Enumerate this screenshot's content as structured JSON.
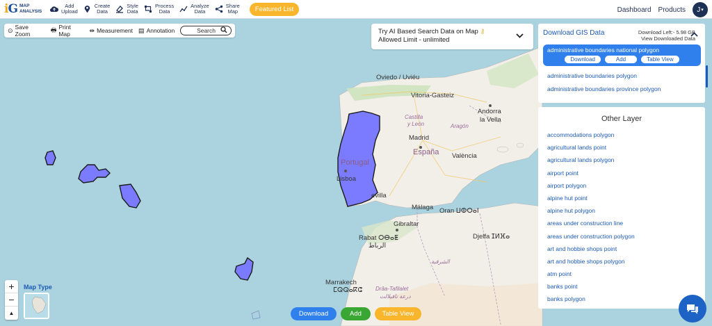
{
  "brand": {
    "mark_i": "i",
    "mark_g": "G",
    "line1": "MAP",
    "line2": "ANALYSIS"
  },
  "nav": [
    {
      "id": "add-upload",
      "line1": "Add",
      "line2": "Upload",
      "icon": "cloud-upload-icon"
    },
    {
      "id": "create-data",
      "line1": "Create",
      "line2": "Data",
      "icon": "map-pin-icon"
    },
    {
      "id": "style-data",
      "line1": "Style",
      "line2": "Data",
      "icon": "style-icon"
    },
    {
      "id": "process-data",
      "line1": "Process",
      "line2": "Data",
      "icon": "process-icon"
    },
    {
      "id": "analyze-data",
      "line1": "Analyze",
      "line2": "Data",
      "icon": "analyze-icon"
    },
    {
      "id": "share-map",
      "line1": "Share",
      "line2": "Map",
      "icon": "share-icon"
    }
  ],
  "featured_label": "Featured List",
  "top_right": {
    "dashboard": "Dashboard",
    "products": "Products",
    "avatar_initial": "J"
  },
  "toolbar": {
    "save_zoom": "Save Zoom",
    "print_map": "Print Map",
    "measurement": "Measurement",
    "annotation": "Annotation",
    "search": "Search"
  },
  "ai_search": {
    "line1": "Try AI Based Search Data on Map",
    "line2": "Allowed Limit - unlimited"
  },
  "gis_panel": {
    "title": "Download GIS Data",
    "download_left": "Download Left:- 5.98 GB",
    "view_downloaded": "View Downloaded Data",
    "selected": {
      "label": "administrative boundaries national polygon",
      "download": "Download",
      "add": "Add",
      "table_view": "Table View"
    },
    "items": [
      "administrative boundaries polygon",
      "administrative boundaries province polygon"
    ]
  },
  "other_layer": {
    "title": "Other Layer",
    "items": [
      "accommodations polygon",
      "agricultural lands point",
      "agricultural lands polygon",
      "airport point",
      "airport polygon",
      "alpine hut point",
      "alpine hut polygon",
      "areas under construction line",
      "areas under construction polygon",
      "art and hobbie shops point",
      "art and hobbie shops polygon",
      "atm point",
      "banks point",
      "banks polygon"
    ]
  },
  "map_labels": {
    "oviedo": "Oviedo / Uviéu",
    "vitoria": "Vitoria-Gasteiz",
    "castilla": "Castilla",
    "y_leon": "y León",
    "andorra": "Andorra",
    "la_vella": "la Vella",
    "aragon": "Aragón",
    "madrid": "Madrid",
    "espana": "España",
    "valencia": "València",
    "portugal": "Portugal",
    "lisboa": "Lisboa",
    "sevilla": "evilla",
    "malaga": "Málaga",
    "oran": "Oran ⵡⵀⵔⴰⵏ",
    "gibraltar": "Gibraltar",
    "rabat": "Rabat ⵔⴱⴰⵟ",
    "rabat_ar": "الرباط",
    "djelfa": "Djelfa ⵊⵍⴼⴰ",
    "marrakech": "Marrakech",
    "marrakech_tf": "ⵎⵕⵕⴰⴽⵛ",
    "draa": "Drâa-Tafilalet",
    "draa_ar": "درعة تافيلالت",
    "region_ar": "الشرقية"
  },
  "map_type_label": "Map Type",
  "zoom": {
    "in": "+",
    "out": "−",
    "north": "▲"
  },
  "bottom_buttons": {
    "download": "Download",
    "add": "Add",
    "table_view": "Table View"
  },
  "colors": {
    "highlight_fill": "#7b7bff",
    "sea": "#aad3df",
    "land": "#f2efe9",
    "accent_blue": "#2f80ed",
    "accent_green": "#3aa735",
    "accent_orange": "#f9b52b"
  }
}
